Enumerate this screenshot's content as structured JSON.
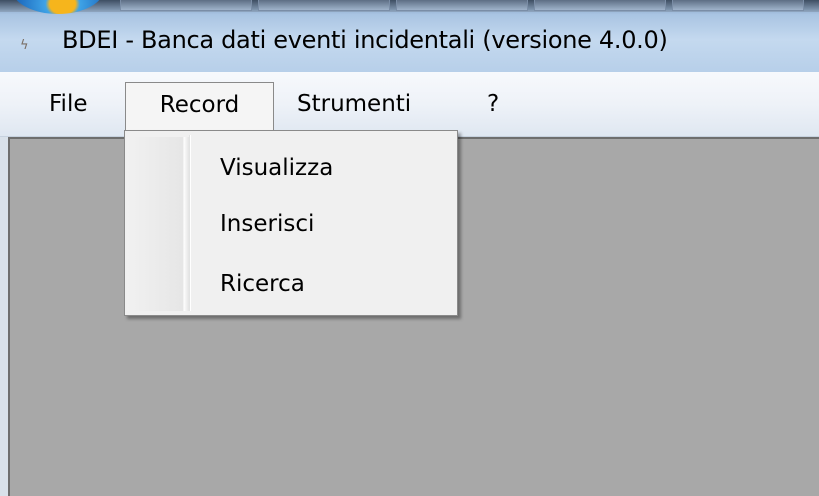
{
  "window": {
    "title": "BDEI - Banca dati eventi incidentali (versione 4.0.0)"
  },
  "menubar": {
    "items": [
      {
        "label": "File"
      },
      {
        "label": "Record"
      },
      {
        "label": "Strumenti"
      },
      {
        "label": "?"
      }
    ]
  },
  "record_menu": {
    "items": [
      {
        "label": "Visualizza"
      },
      {
        "label": "Inserisci"
      },
      {
        "label": "Ricerca"
      }
    ]
  },
  "icons": {
    "app": "app-icon",
    "orb": "start-orb-icon"
  },
  "colors": {
    "client_background": "#a8a8a8",
    "menu_background": "#f0f0f0",
    "titlebar": "#c4d9ef"
  }
}
